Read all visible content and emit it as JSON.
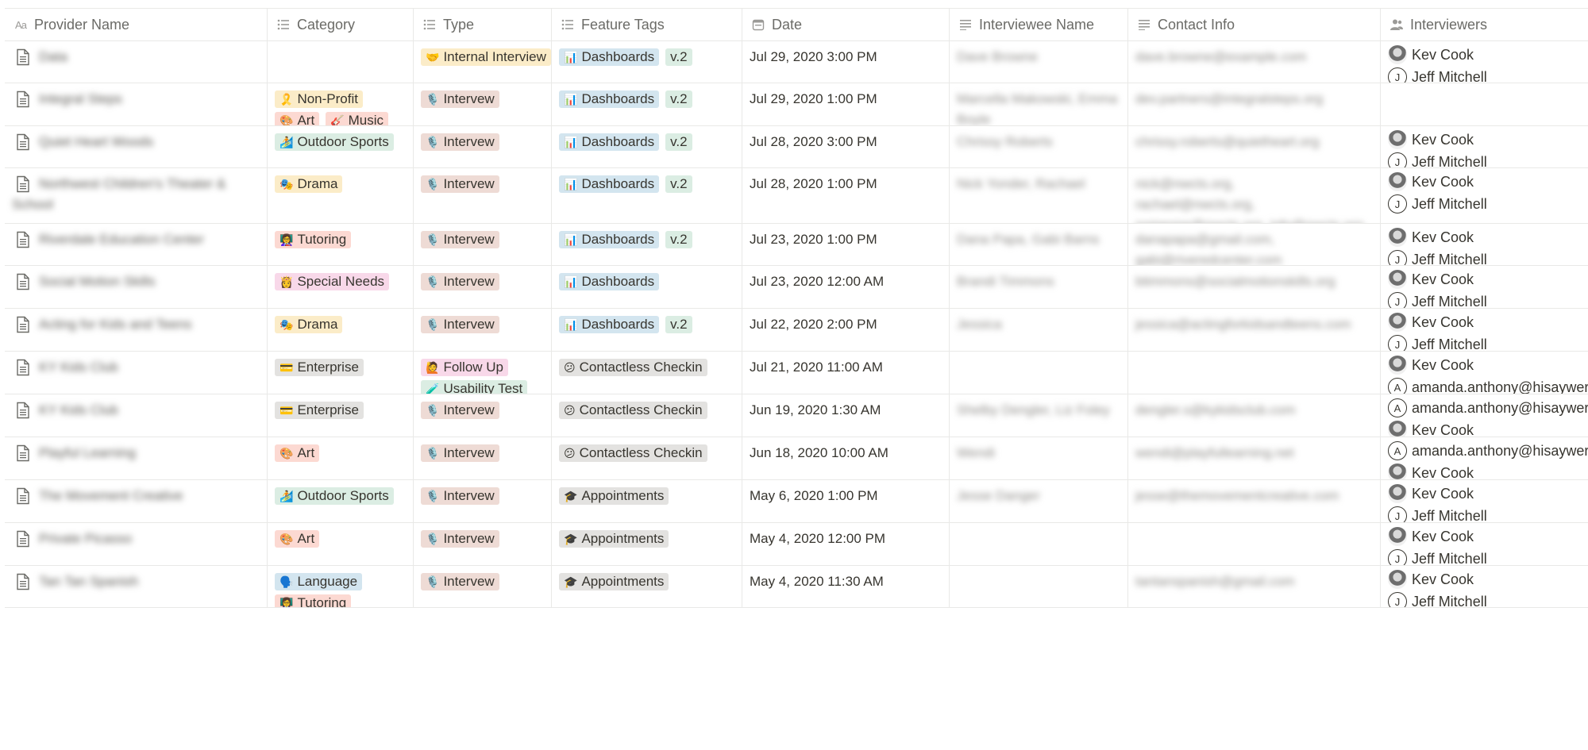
{
  "columns": [
    {
      "label": "Provider Name",
      "icon": "title-aa-icon"
    },
    {
      "label": "Category",
      "icon": "list-icon"
    },
    {
      "label": "Type",
      "icon": "list-icon"
    },
    {
      "label": "Feature Tags",
      "icon": "list-icon"
    },
    {
      "label": "Date",
      "icon": "calendar-icon"
    },
    {
      "label": "Interviewee Name",
      "icon": "text-lines-icon"
    },
    {
      "label": "Contact Info",
      "icon": "text-lines-icon"
    },
    {
      "label": "Interviewers",
      "icon": "people-icon"
    }
  ],
  "colors": {
    "border": "#e9e9e7",
    "text": "#37352f",
    "header_text": "#6b6b67"
  },
  "rows": [
    {
      "provider": "Data",
      "categories": [],
      "types": [
        {
          "emoji": "🤝",
          "label": "Internal Interview",
          "color": "yellow"
        }
      ],
      "features": [
        {
          "emoji": "📊",
          "label": "Dashboards",
          "color": "blue"
        },
        {
          "emoji": "",
          "label": "v.2",
          "color": "green"
        }
      ],
      "date": "Jul 29, 2020 3:00 PM",
      "interviewee": [
        "Dave Browne"
      ],
      "contact": [
        "dave.browne@example.com"
      ],
      "interviewers": [
        {
          "name": "Kev Cook",
          "avatar": "photo"
        },
        {
          "name": "Jeff Mitchell",
          "avatar": "letter",
          "letter": "J"
        }
      ],
      "h": 52
    },
    {
      "provider": "Integral Steps",
      "categories": [
        {
          "emoji": "🎗️",
          "label": "Non-Profit",
          "color": "yellow"
        },
        {
          "emoji": "🎨",
          "label": "Art",
          "color": "red"
        },
        {
          "emoji": "🎸",
          "label": "Music",
          "color": "red"
        }
      ],
      "types": [
        {
          "emoji": "🎙️",
          "label": "Intervew",
          "color": "brown"
        }
      ],
      "features": [
        {
          "emoji": "📊",
          "label": "Dashboards",
          "color": "blue"
        },
        {
          "emoji": "",
          "label": "v.2",
          "color": "green"
        }
      ],
      "date": "Jul 29, 2020 1:00 PM",
      "interviewee": [
        "Marcella Makowski, Emma",
        "Boyle"
      ],
      "contact": [
        "dev.partners@integralsteps.org"
      ],
      "interviewers": [],
      "h": 53
    },
    {
      "provider": "Quiet Heart Woods",
      "categories": [
        {
          "emoji": "🏄",
          "label": "Outdoor Sports",
          "color": "green"
        }
      ],
      "types": [
        {
          "emoji": "🎙️",
          "label": "Intervew",
          "color": "brown"
        }
      ],
      "features": [
        {
          "emoji": "📊",
          "label": "Dashboards",
          "color": "blue"
        },
        {
          "emoji": "",
          "label": "v.2",
          "color": "green"
        }
      ],
      "date": "Jul 28, 2020 3:00 PM",
      "interviewee": [
        "Chrissy Roberts"
      ],
      "contact": [
        "chrissy.roberts@quietheart.org"
      ],
      "interviewers": [
        {
          "name": "Kev Cook",
          "avatar": "photo"
        },
        {
          "name": "Jeff Mitchell",
          "avatar": "letter",
          "letter": "J"
        }
      ],
      "h": 52
    },
    {
      "provider": "Northwest Children's Theater &",
      "provider2": "School",
      "categories": [
        {
          "emoji": "🎭",
          "label": "Drama",
          "color": "yellow"
        }
      ],
      "types": [
        {
          "emoji": "🎙️",
          "label": "Intervew",
          "color": "brown"
        }
      ],
      "features": [
        {
          "emoji": "📊",
          "label": "Dashboards",
          "color": "blue"
        },
        {
          "emoji": "",
          "label": "v.2",
          "color": "green"
        }
      ],
      "date": "Jul 28, 2020 1:00 PM",
      "interviewee": [
        "Nick Yonder, Rachael"
      ],
      "contact": [
        "nick@nwcts.org,",
        "rachael@nwcts.org,",
        "someone@nwcts.org, info@nwcts.org"
      ],
      "interviewers": [
        {
          "name": "Kev Cook",
          "avatar": "photo"
        },
        {
          "name": "Jeff Mitchell",
          "avatar": "letter",
          "letter": "J"
        }
      ],
      "h": 69
    },
    {
      "provider": "Riverdale Education Center",
      "categories": [
        {
          "emoji": "👩‍🏫",
          "label": "Tutoring",
          "color": "red"
        }
      ],
      "types": [
        {
          "emoji": "🎙️",
          "label": "Intervew",
          "color": "brown"
        }
      ],
      "features": [
        {
          "emoji": "📊",
          "label": "Dashboards",
          "color": "blue"
        },
        {
          "emoji": "",
          "label": "v.2",
          "color": "green"
        }
      ],
      "date": "Jul 23, 2020 1:00 PM",
      "interviewee": [
        "Dana Papa, Gabi Barns"
      ],
      "contact": [
        "danapapa@gmail.com,",
        "gabi@riveredcenter.com"
      ],
      "interviewers": [
        {
          "name": "Kev Cook",
          "avatar": "photo"
        },
        {
          "name": "Jeff Mitchell",
          "avatar": "letter",
          "letter": "J"
        }
      ],
      "h": 52
    },
    {
      "provider": "Social Motion Skills",
      "categories": [
        {
          "emoji": "👸",
          "label": "Special Needs",
          "color": "pink"
        }
      ],
      "types": [
        {
          "emoji": "🎙️",
          "label": "Intervew",
          "color": "brown"
        }
      ],
      "features": [
        {
          "emoji": "📊",
          "label": "Dashboards",
          "color": "blue"
        }
      ],
      "date": "Jul 23, 2020 12:00 AM",
      "interviewee": [
        "Brandi Timmons"
      ],
      "contact": [
        "btimmons@socialmotionskills.org"
      ],
      "interviewers": [
        {
          "name": "Kev Cook",
          "avatar": "photo"
        },
        {
          "name": "Jeff Mitchell",
          "avatar": "letter",
          "letter": "J"
        }
      ],
      "h": 53
    },
    {
      "provider": "Acting for Kids and Teens",
      "categories": [
        {
          "emoji": "🎭",
          "label": "Drama",
          "color": "yellow"
        }
      ],
      "types": [
        {
          "emoji": "🎙️",
          "label": "Intervew",
          "color": "brown"
        }
      ],
      "features": [
        {
          "emoji": "📊",
          "label": "Dashboards",
          "color": "blue"
        },
        {
          "emoji": "",
          "label": "v.2",
          "color": "green"
        }
      ],
      "date": "Jul 22, 2020 2:00 PM",
      "interviewee": [
        "Jessica"
      ],
      "contact": [
        "jessica@actingforkidsandteens.com"
      ],
      "interviewers": [
        {
          "name": "Kev Cook",
          "avatar": "photo"
        },
        {
          "name": "Jeff Mitchell",
          "avatar": "letter",
          "letter": "J"
        }
      ],
      "h": 53
    },
    {
      "provider": "KY Kids Club",
      "categories": [
        {
          "emoji": "💳",
          "label": "Enterprise",
          "color": "gray"
        }
      ],
      "types": [
        {
          "emoji": "🙋",
          "label": "Follow Up",
          "color": "pink"
        },
        {
          "emoji": "🧪",
          "label": "Usability Test",
          "color": "green"
        }
      ],
      "features": [
        {
          "emoji": "😕",
          "label": "Contactless Checkin",
          "color": "gray"
        }
      ],
      "date": "Jul 21, 2020 11:00 AM",
      "interviewee": [],
      "contact": [],
      "interviewers": [
        {
          "name": "Kev Cook",
          "avatar": "photo"
        },
        {
          "name": "amanda.anthony@hisaywer.co",
          "avatar": "letter",
          "letter": "A"
        }
      ],
      "h": 53
    },
    {
      "provider": "KY Kids Club",
      "categories": [
        {
          "emoji": "💳",
          "label": "Enterprise",
          "color": "gray"
        }
      ],
      "types": [
        {
          "emoji": "🎙️",
          "label": "Intervew",
          "color": "brown"
        }
      ],
      "features": [
        {
          "emoji": "😕",
          "label": "Contactless Checkin",
          "color": "gray"
        }
      ],
      "date": "Jun 19, 2020 1:30 AM",
      "interviewee": [
        "Shelby Dengler, Liz Foley"
      ],
      "contact": [
        "dengler.s@kykidsclub.com"
      ],
      "interviewers": [
        {
          "name": "amanda.anthony@hisaywer.co",
          "avatar": "letter",
          "letter": "A"
        },
        {
          "name": "Kev Cook",
          "avatar": "photo"
        }
      ],
      "h": 53
    },
    {
      "provider": "Playful Learning",
      "categories": [
        {
          "emoji": "🎨",
          "label": "Art",
          "color": "red"
        }
      ],
      "types": [
        {
          "emoji": "🎙️",
          "label": "Intervew",
          "color": "brown"
        }
      ],
      "features": [
        {
          "emoji": "😕",
          "label": "Contactless Checkin",
          "color": "gray"
        }
      ],
      "date": "Jun 18, 2020 10:00 AM",
      "interviewee": [
        "Wendi"
      ],
      "contact": [
        "wendi@playfullearning.net"
      ],
      "interviewers": [
        {
          "name": "amanda.anthony@hisaywer.co",
          "avatar": "letter",
          "letter": "A"
        },
        {
          "name": "Kev Cook",
          "avatar": "photo"
        }
      ],
      "h": 53
    },
    {
      "provider": "The Movement Creative",
      "categories": [
        {
          "emoji": "🏄",
          "label": "Outdoor Sports",
          "color": "green"
        }
      ],
      "types": [
        {
          "emoji": "🎙️",
          "label": "Intervew",
          "color": "brown"
        }
      ],
      "features": [
        {
          "emoji": "🎓",
          "label": "Appointments",
          "color": "gray"
        }
      ],
      "date": "May 6, 2020 1:00 PM",
      "interviewee": [
        "Jesse Danger"
      ],
      "contact": [
        "jesse@themovementcreative.com"
      ],
      "interviewers": [
        {
          "name": "Kev Cook",
          "avatar": "photo"
        },
        {
          "name": "Jeff Mitchell",
          "avatar": "letter",
          "letter": "J"
        }
      ],
      "h": 53
    },
    {
      "provider": "Private Picasso",
      "categories": [
        {
          "emoji": "🎨",
          "label": "Art",
          "color": "red"
        }
      ],
      "types": [
        {
          "emoji": "🎙️",
          "label": "Intervew",
          "color": "brown"
        }
      ],
      "features": [
        {
          "emoji": "🎓",
          "label": "Appointments",
          "color": "gray"
        }
      ],
      "date": "May 4, 2020 12:00 PM",
      "interviewee": [],
      "contact": [],
      "interviewers": [
        {
          "name": "Kev Cook",
          "avatar": "photo"
        },
        {
          "name": "Jeff Mitchell",
          "avatar": "letter",
          "letter": "J"
        }
      ],
      "h": 53
    },
    {
      "provider": "Tan Tan Spanish",
      "categories": [
        {
          "emoji": "🗣️",
          "label": "Language",
          "color": "blue"
        },
        {
          "emoji": "👩‍🏫",
          "label": "Tutoring",
          "color": "red"
        }
      ],
      "types": [
        {
          "emoji": "🎙️",
          "label": "Intervew",
          "color": "brown"
        }
      ],
      "features": [
        {
          "emoji": "🎓",
          "label": "Appointments",
          "color": "gray"
        }
      ],
      "date": "May 4, 2020 11:30 AM",
      "interviewee": [],
      "contact": [
        "tantanspanish@gmail.com"
      ],
      "interviewers": [
        {
          "name": "Kev Cook",
          "avatar": "photo"
        },
        {
          "name": "Jeff Mitchell",
          "avatar": "letter",
          "letter": "J"
        }
      ],
      "h": 52
    }
  ]
}
